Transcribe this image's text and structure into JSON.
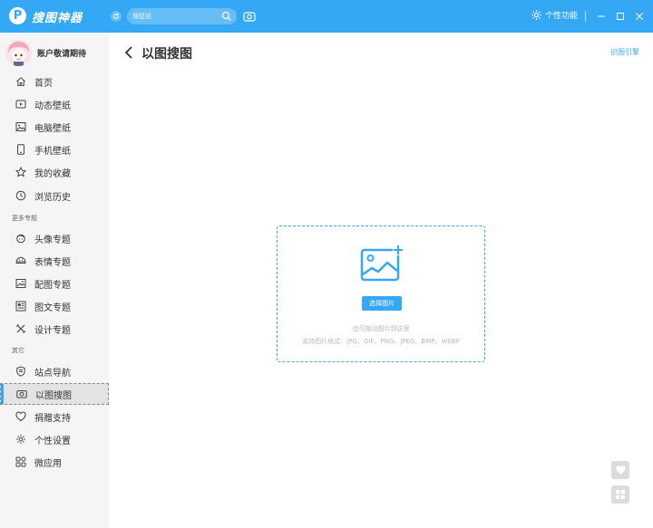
{
  "app": {
    "title": "搜图神器",
    "logo_letter": "P",
    "brand_color": "#35a8f5"
  },
  "header": {
    "search_placeholder": "搜壁纸",
    "personal_label": "个性功能"
  },
  "user": {
    "name": "账户敬请期待"
  },
  "sidebar": {
    "items": [
      {
        "label": "首页",
        "icon": "home-icon"
      },
      {
        "label": "动态壁纸",
        "icon": "video-icon"
      },
      {
        "label": "电脑壁纸",
        "icon": "image-icon"
      },
      {
        "label": "手机壁纸",
        "icon": "phone-icon"
      },
      {
        "label": "我的收藏",
        "icon": "star-icon"
      },
      {
        "label": "浏览历史",
        "icon": "clock-icon"
      }
    ],
    "section_more": "更多专题",
    "more_items": [
      {
        "label": "头像专题",
        "icon": "avatar-icon"
      },
      {
        "label": "表情专题",
        "icon": "emoji-icon"
      },
      {
        "label": "配图专题",
        "icon": "picture-icon"
      },
      {
        "label": "图文专题",
        "icon": "article-icon"
      },
      {
        "label": "设计专题",
        "icon": "design-icon"
      }
    ],
    "section_other": "其它",
    "other_items": [
      {
        "label": "站点导航",
        "icon": "shield-icon"
      },
      {
        "label": "以图搜图",
        "icon": "camera-icon",
        "active": true
      },
      {
        "label": "捐赠支持",
        "icon": "heart-icon"
      },
      {
        "label": "个性设置",
        "icon": "gear-icon"
      },
      {
        "label": "微应用",
        "icon": "apps-icon"
      }
    ]
  },
  "main": {
    "title": "以图搜图",
    "disclaimer": "识图引擎",
    "upload": {
      "button_label": "选择图片",
      "hint_drag": "也可拖动图片到这里",
      "hint_formats": "支持图片格式：JPG、GIF、PNG、JPEG、BMP、WEBP"
    }
  }
}
